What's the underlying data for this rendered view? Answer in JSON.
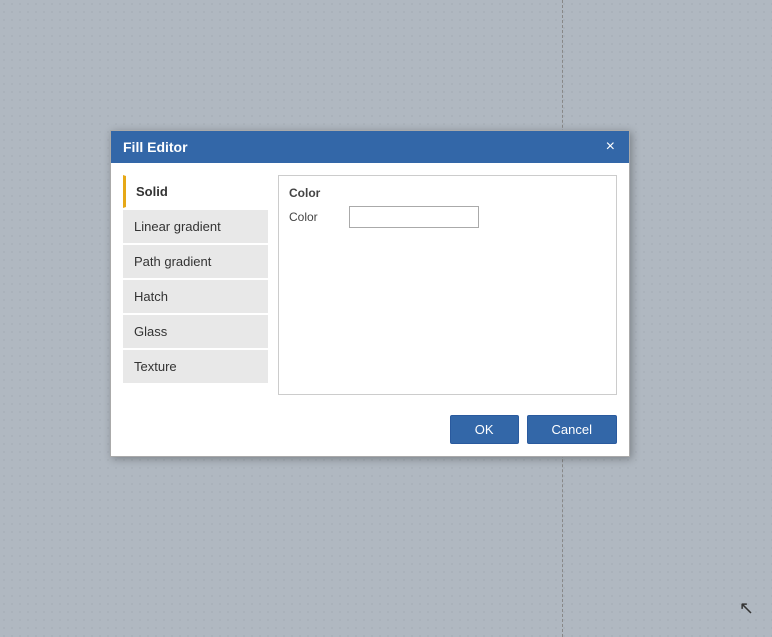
{
  "background": {
    "color": "#b0b8c1"
  },
  "dialog": {
    "title": "Fill Editor",
    "close_label": "×",
    "fill_types": [
      {
        "id": "solid",
        "label": "Solid",
        "active": true
      },
      {
        "id": "linear-gradient",
        "label": "Linear gradient",
        "active": false
      },
      {
        "id": "path-gradient",
        "label": "Path gradient",
        "active": false
      },
      {
        "id": "hatch",
        "label": "Hatch",
        "active": false
      },
      {
        "id": "glass",
        "label": "Glass",
        "active": false
      },
      {
        "id": "texture",
        "label": "Texture",
        "active": false
      }
    ],
    "properties": {
      "section_label": "Color",
      "color_label": "Color",
      "color_value": ""
    },
    "footer": {
      "ok_label": "OK",
      "cancel_label": "Cancel"
    }
  }
}
